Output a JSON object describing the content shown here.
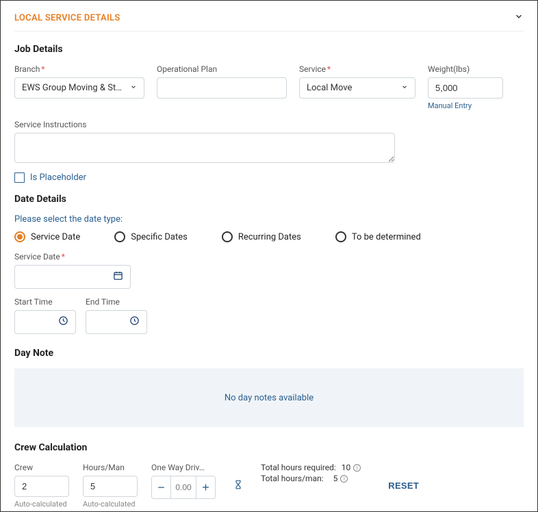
{
  "header": {
    "title": "LOCAL SERVICE DETAILS"
  },
  "job": {
    "title": "Job Details",
    "branch_label": "Branch",
    "branch_value": "EWS Group Moving & St…",
    "opplan_label": "Operational Plan",
    "opplan_value": "",
    "service_label": "Service",
    "service_value": "Local Move",
    "weight_label": "Weight(lbs)",
    "weight_value": "5,000",
    "weight_helper": "Manual Entry",
    "instructions_label": "Service Instructions",
    "instructions_value": "",
    "placeholder_label": "Is Placeholder"
  },
  "date": {
    "title": "Date Details",
    "prompt": "Please select the date type:",
    "options": [
      "Service Date",
      "Specific Dates",
      "Recurring Dates",
      "To be determined"
    ],
    "service_date_label": "Service Date",
    "start_label": "Start Time",
    "end_label": "End Time"
  },
  "daynote": {
    "title": "Day Note",
    "empty": "No day notes available"
  },
  "crew": {
    "title": "Crew Calculation",
    "crew_label": "Crew",
    "crew_value": "2",
    "hours_label": "Hours/Man",
    "hours_value": "5",
    "drive_label": "One Way Driv…",
    "drive_value": "0.00",
    "auto": "Auto-calculated",
    "total_req_label": "Total hours required:",
    "total_req_value": "10",
    "total_man_label": "Total hours/man:",
    "total_man_value": "5",
    "reset": "RESET"
  }
}
